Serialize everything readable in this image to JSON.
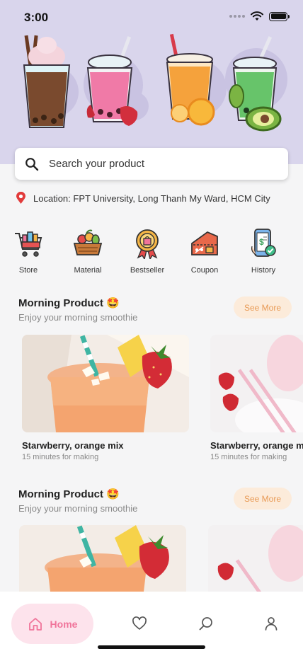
{
  "status_bar": {
    "time": "3:00"
  },
  "search": {
    "placeholder": "Search your product"
  },
  "location": {
    "text": "Location: FPT University, Long Thanh My Ward, HCM City"
  },
  "categories": [
    {
      "label": "Store",
      "icon": "shopping-cart-icon"
    },
    {
      "label": "Material",
      "icon": "fruit-basket-icon"
    },
    {
      "label": "Bestseller",
      "icon": "award-badge-icon"
    },
    {
      "label": "Coupon",
      "icon": "coupon-tag-icon"
    },
    {
      "label": "History",
      "icon": "phone-history-icon"
    }
  ],
  "sections": [
    {
      "title": "Morning Product 🤩",
      "subtitle": "Enjoy your morning smoothie",
      "see_more": "See More",
      "products": [
        {
          "name": "Starwberry, orange mix",
          "meta": "15 minutes for making"
        },
        {
          "name": "Starwberry, orange mix",
          "meta": "15 minutes for making"
        }
      ]
    },
    {
      "title": "Morning Product 🤩",
      "subtitle": "Enjoy your morning smoothie",
      "see_more": "See More",
      "products": [
        {
          "name": "",
          "meta": ""
        },
        {
          "name": "",
          "meta": ""
        }
      ]
    }
  ],
  "bottom_nav": {
    "home_label": "Home",
    "items": [
      "home-icon",
      "heart-icon",
      "search-icon",
      "profile-icon"
    ],
    "active": "Home"
  },
  "colors": {
    "hero_bg": "#d9d5ec",
    "accent_pink": "#f0749a",
    "accent_pink_bg": "#fde3ec",
    "see_more_bg": "#fcebda",
    "see_more_text": "#e89a55"
  }
}
